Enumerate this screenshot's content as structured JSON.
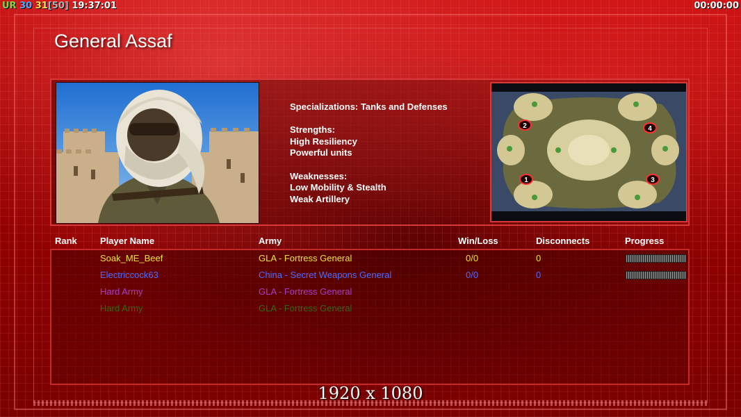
{
  "hud": {
    "ur_label": "UR",
    "fps": "30",
    "fps_alt": "31",
    "fps_cap": "[50]",
    "clock": "19:37:01",
    "game_timer": "00:00:00"
  },
  "general_name": "General Assaf",
  "info": {
    "specializations": "Specializations: Tanks and Defenses",
    "strengths_label": "Strengths:",
    "strengths": [
      "High Resiliency",
      "Powerful units"
    ],
    "weaknesses_label": "Weaknesses:",
    "weaknesses": [
      "Low Mobility & Stealth",
      "Weak Artillery"
    ]
  },
  "map": {
    "start_positions": [
      "1",
      "2",
      "3",
      "4"
    ]
  },
  "columns": {
    "rank": "Rank",
    "player_name": "Player Name",
    "army": "Army",
    "win_loss": "Win/Loss",
    "disconnects": "Disconnects",
    "progress": "Progress"
  },
  "players": [
    {
      "name": "Soak_ME_Beef",
      "army": "GLA - Fortress General",
      "win_loss": "0/0",
      "disconnects": "0",
      "color": "#e8e23a",
      "has_progress": true
    },
    {
      "name": "Electriccock63",
      "army": "China - Secret Weapons General",
      "win_loss": "0/0",
      "disconnects": "0",
      "color": "#4f6bff",
      "has_progress": true
    },
    {
      "name": "Hard Army",
      "army": "GLA - Fortress General",
      "win_loss": "",
      "disconnects": "",
      "color": "#a43cc8",
      "has_progress": false
    },
    {
      "name": "Hard Army",
      "army": "GLA - Fortress General",
      "win_loss": "",
      "disconnects": "",
      "color": "#2e6a16",
      "has_progress": false
    }
  ],
  "resolution_label": "1920 x 1080",
  "colors": {
    "accent": "#d83a3a",
    "background": "#9a0000"
  }
}
